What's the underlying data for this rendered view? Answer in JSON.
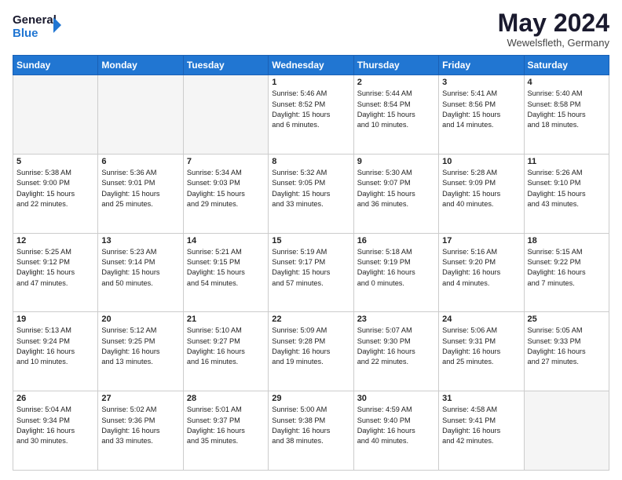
{
  "header": {
    "logo_line1": "General",
    "logo_line2": "Blue",
    "month": "May 2024",
    "location": "Wewelsfleth, Germany"
  },
  "weekdays": [
    "Sunday",
    "Monday",
    "Tuesday",
    "Wednesday",
    "Thursday",
    "Friday",
    "Saturday"
  ],
  "weeks": [
    [
      {
        "day": "",
        "info": ""
      },
      {
        "day": "",
        "info": ""
      },
      {
        "day": "",
        "info": ""
      },
      {
        "day": "1",
        "info": "Sunrise: 5:46 AM\nSunset: 8:52 PM\nDaylight: 15 hours\nand 6 minutes."
      },
      {
        "day": "2",
        "info": "Sunrise: 5:44 AM\nSunset: 8:54 PM\nDaylight: 15 hours\nand 10 minutes."
      },
      {
        "day": "3",
        "info": "Sunrise: 5:41 AM\nSunset: 8:56 PM\nDaylight: 15 hours\nand 14 minutes."
      },
      {
        "day": "4",
        "info": "Sunrise: 5:40 AM\nSunset: 8:58 PM\nDaylight: 15 hours\nand 18 minutes."
      }
    ],
    [
      {
        "day": "5",
        "info": "Sunrise: 5:38 AM\nSunset: 9:00 PM\nDaylight: 15 hours\nand 22 minutes."
      },
      {
        "day": "6",
        "info": "Sunrise: 5:36 AM\nSunset: 9:01 PM\nDaylight: 15 hours\nand 25 minutes."
      },
      {
        "day": "7",
        "info": "Sunrise: 5:34 AM\nSunset: 9:03 PM\nDaylight: 15 hours\nand 29 minutes."
      },
      {
        "day": "8",
        "info": "Sunrise: 5:32 AM\nSunset: 9:05 PM\nDaylight: 15 hours\nand 33 minutes."
      },
      {
        "day": "9",
        "info": "Sunrise: 5:30 AM\nSunset: 9:07 PM\nDaylight: 15 hours\nand 36 minutes."
      },
      {
        "day": "10",
        "info": "Sunrise: 5:28 AM\nSunset: 9:09 PM\nDaylight: 15 hours\nand 40 minutes."
      },
      {
        "day": "11",
        "info": "Sunrise: 5:26 AM\nSunset: 9:10 PM\nDaylight: 15 hours\nand 43 minutes."
      }
    ],
    [
      {
        "day": "12",
        "info": "Sunrise: 5:25 AM\nSunset: 9:12 PM\nDaylight: 15 hours\nand 47 minutes."
      },
      {
        "day": "13",
        "info": "Sunrise: 5:23 AM\nSunset: 9:14 PM\nDaylight: 15 hours\nand 50 minutes."
      },
      {
        "day": "14",
        "info": "Sunrise: 5:21 AM\nSunset: 9:15 PM\nDaylight: 15 hours\nand 54 minutes."
      },
      {
        "day": "15",
        "info": "Sunrise: 5:19 AM\nSunset: 9:17 PM\nDaylight: 15 hours\nand 57 minutes."
      },
      {
        "day": "16",
        "info": "Sunrise: 5:18 AM\nSunset: 9:19 PM\nDaylight: 16 hours\nand 0 minutes."
      },
      {
        "day": "17",
        "info": "Sunrise: 5:16 AM\nSunset: 9:20 PM\nDaylight: 16 hours\nand 4 minutes."
      },
      {
        "day": "18",
        "info": "Sunrise: 5:15 AM\nSunset: 9:22 PM\nDaylight: 16 hours\nand 7 minutes."
      }
    ],
    [
      {
        "day": "19",
        "info": "Sunrise: 5:13 AM\nSunset: 9:24 PM\nDaylight: 16 hours\nand 10 minutes."
      },
      {
        "day": "20",
        "info": "Sunrise: 5:12 AM\nSunset: 9:25 PM\nDaylight: 16 hours\nand 13 minutes."
      },
      {
        "day": "21",
        "info": "Sunrise: 5:10 AM\nSunset: 9:27 PM\nDaylight: 16 hours\nand 16 minutes."
      },
      {
        "day": "22",
        "info": "Sunrise: 5:09 AM\nSunset: 9:28 PM\nDaylight: 16 hours\nand 19 minutes."
      },
      {
        "day": "23",
        "info": "Sunrise: 5:07 AM\nSunset: 9:30 PM\nDaylight: 16 hours\nand 22 minutes."
      },
      {
        "day": "24",
        "info": "Sunrise: 5:06 AM\nSunset: 9:31 PM\nDaylight: 16 hours\nand 25 minutes."
      },
      {
        "day": "25",
        "info": "Sunrise: 5:05 AM\nSunset: 9:33 PM\nDaylight: 16 hours\nand 27 minutes."
      }
    ],
    [
      {
        "day": "26",
        "info": "Sunrise: 5:04 AM\nSunset: 9:34 PM\nDaylight: 16 hours\nand 30 minutes."
      },
      {
        "day": "27",
        "info": "Sunrise: 5:02 AM\nSunset: 9:36 PM\nDaylight: 16 hours\nand 33 minutes."
      },
      {
        "day": "28",
        "info": "Sunrise: 5:01 AM\nSunset: 9:37 PM\nDaylight: 16 hours\nand 35 minutes."
      },
      {
        "day": "29",
        "info": "Sunrise: 5:00 AM\nSunset: 9:38 PM\nDaylight: 16 hours\nand 38 minutes."
      },
      {
        "day": "30",
        "info": "Sunrise: 4:59 AM\nSunset: 9:40 PM\nDaylight: 16 hours\nand 40 minutes."
      },
      {
        "day": "31",
        "info": "Sunrise: 4:58 AM\nSunset: 9:41 PM\nDaylight: 16 hours\nand 42 minutes."
      },
      {
        "day": "",
        "info": ""
      }
    ]
  ]
}
